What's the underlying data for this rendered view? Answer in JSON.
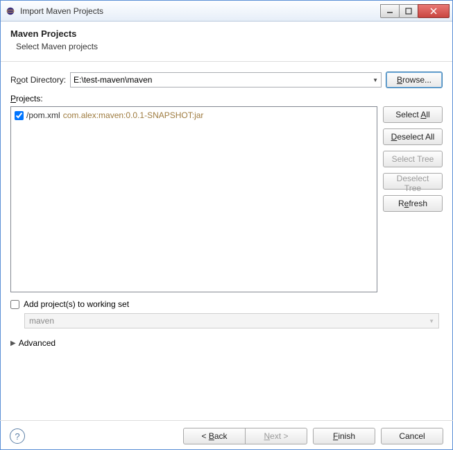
{
  "window": {
    "title": "Import Maven Projects"
  },
  "header": {
    "title": "Maven Projects",
    "subtitle": "Select Maven projects"
  },
  "root": {
    "label_pre": "R",
    "label_u": "o",
    "label_post": "ot Directory:",
    "value": "E:\\test-maven\\maven",
    "browse_u": "B",
    "browse_post": "rowse..."
  },
  "projects": {
    "label_u": "P",
    "label_post": "rojects:",
    "items": [
      {
        "checked": true,
        "path": "/pom.xml",
        "coords": "com.alex:maven:0.0.1-SNAPSHOT:jar"
      }
    ],
    "buttons": {
      "select_all_pre": "Select ",
      "select_all_u": "A",
      "select_all_post": "ll",
      "deselect_all_u": "D",
      "deselect_all_post": "eselect All",
      "select_tree": "Select Tree",
      "deselect_tree": "Deselect Tree",
      "refresh_pre": "R",
      "refresh_u": "e",
      "refresh_post": "fresh"
    }
  },
  "working_set": {
    "checkbox_label": "Add project(s) to working set",
    "value": "maven"
  },
  "advanced": {
    "label": "Advanced"
  },
  "footer": {
    "back_pre": "< ",
    "back_u": "B",
    "back_post": "ack",
    "next_u": "N",
    "next_post": "ext >",
    "finish_u": "F",
    "finish_post": "inish",
    "cancel": "Cancel"
  }
}
